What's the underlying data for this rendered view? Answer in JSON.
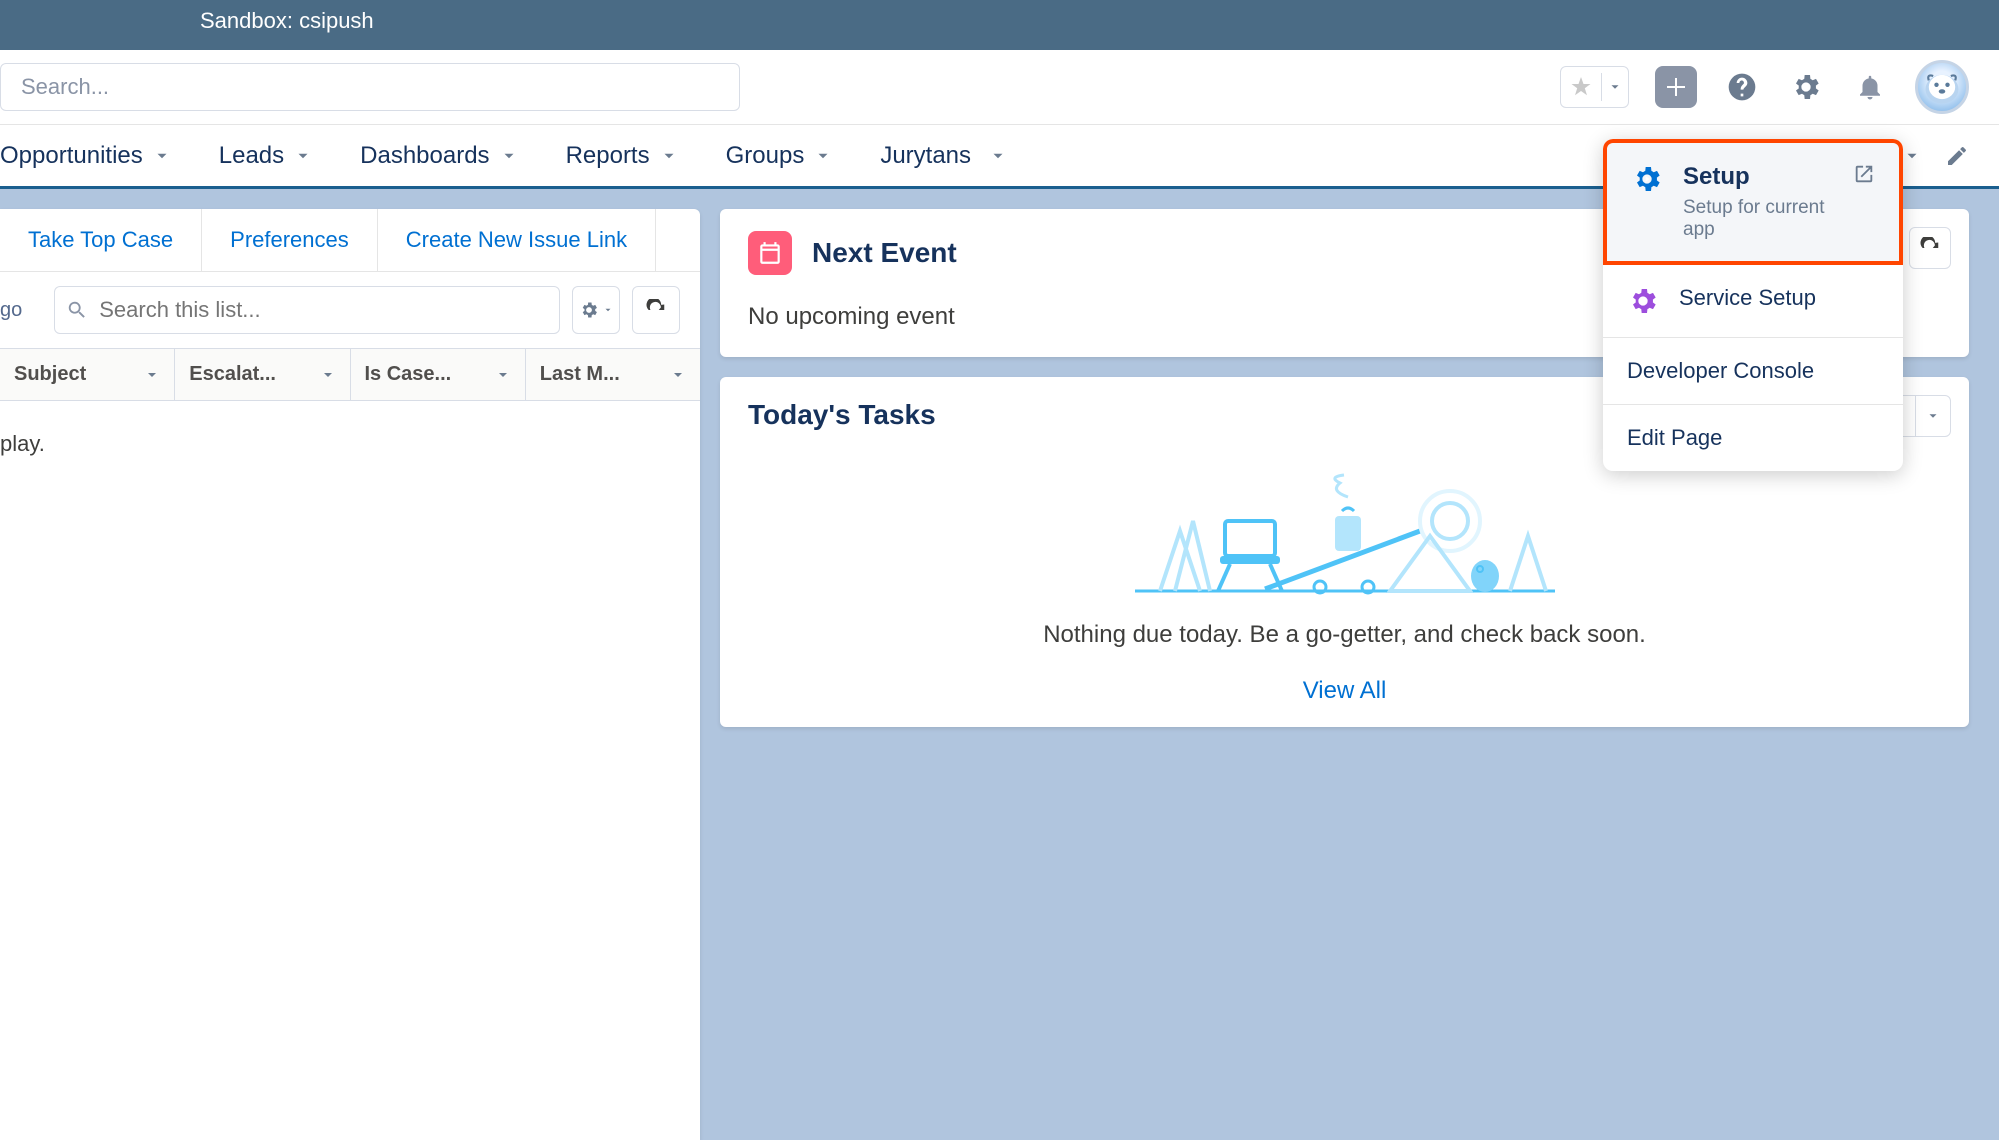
{
  "banner": {
    "text": "Sandbox: csipush"
  },
  "search": {
    "placeholder": "Search..."
  },
  "nav": {
    "items": [
      {
        "label": "Opportunities"
      },
      {
        "label": "Leads"
      },
      {
        "label": "Dashboards"
      },
      {
        "label": "Reports"
      },
      {
        "label": "Groups"
      },
      {
        "label": "Jurytans"
      }
    ]
  },
  "left": {
    "actions": [
      {
        "label": "Take Top Case"
      },
      {
        "label": "Preferences"
      },
      {
        "label": "Create New Issue Link"
      }
    ],
    "timeInfo": "go",
    "listSearchPlaceholder": "Search this list...",
    "columns": [
      {
        "label": "Subject"
      },
      {
        "label": "Escalat..."
      },
      {
        "label": "Is Case..."
      },
      {
        "label": "Last M..."
      }
    ],
    "emptyMessage": "play."
  },
  "nextEvent": {
    "title": "Next Event",
    "message": "No upcoming event"
  },
  "tasks": {
    "title": "Today's Tasks",
    "message": "Nothing due today. Be a go-getter, and check back soon.",
    "viewAll": "View All"
  },
  "setupMenu": {
    "setup": {
      "title": "Setup",
      "sub": "Setup for current app"
    },
    "serviceSetup": "Service Setup",
    "devConsole": "Developer Console",
    "editPage": "Edit Page"
  }
}
